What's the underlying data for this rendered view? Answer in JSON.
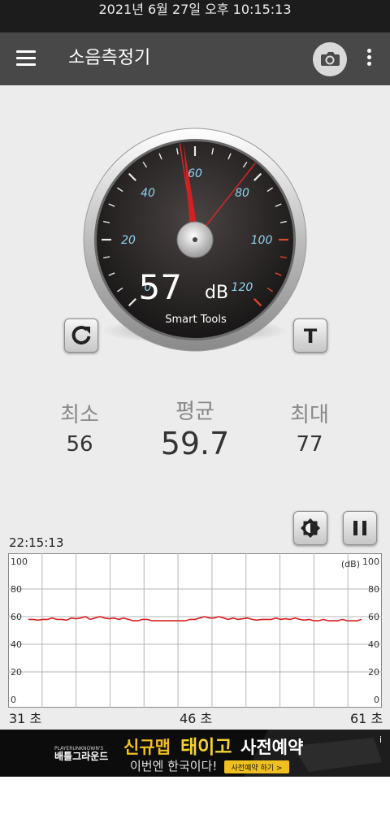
{
  "status_bar": {
    "datetime": "2021년 6월 27일 오후 10:15:13"
  },
  "app_bar": {
    "title": "소음측정기",
    "camera_icon": "camera-icon",
    "menu_icon": "more-vert-icon",
    "nav_icon": "hamburger-icon"
  },
  "gauge": {
    "reading": "57",
    "unit": "dB",
    "brand": "Smart Tools",
    "needle_value": 57,
    "max_marker_value": 77,
    "min_marker_value": 56,
    "scale_labels": [
      "0",
      "20",
      "40",
      "60",
      "80",
      "100",
      "120"
    ],
    "scale_max": 120
  },
  "buttons": {
    "reset_icon": "refresh-icon",
    "calibrate_label": "T",
    "brightness_icon": "brightness-icon",
    "pause_icon": "pause-icon"
  },
  "stats": {
    "min_label": "최소",
    "min_value": "56",
    "avg_label": "평균",
    "avg_value": "59.7",
    "max_label": "최대",
    "max_value": "77"
  },
  "graph": {
    "start_time": "22:15:13",
    "unit_label": "(dB)",
    "y_ticks": [
      "0",
      "20",
      "40",
      "60",
      "80",
      "100"
    ],
    "x_labels": [
      "31 초",
      "46 초",
      "61 초"
    ],
    "line_color": "#d62020"
  },
  "chart_data": {
    "type": "line",
    "ylim": [
      0,
      100
    ],
    "series": [
      {
        "values": [
          58,
          58,
          57.5,
          58,
          58,
          59,
          58,
          58,
          57.5,
          59,
          58.5,
          59,
          60,
          58,
          59,
          60,
          59,
          58.5,
          59,
          58,
          59,
          58,
          57,
          57,
          58,
          58,
          57,
          57,
          57,
          57,
          57,
          57,
          57,
          57,
          58,
          58,
          59,
          60,
          59,
          59,
          60,
          59,
          58,
          59,
          58,
          58.5,
          59,
          58,
          57.5,
          58,
          58,
          58,
          59,
          58,
          58.5,
          58,
          59,
          58,
          57.5,
          58,
          57,
          57,
          58,
          57,
          57,
          57,
          58,
          57,
          57,
          57,
          58
        ]
      }
    ]
  },
  "ad": {
    "game_name": "배틀그라운드",
    "game_tag": "PLAYERUNKNOWN'S",
    "headline_a": "신규맵",
    "headline_b": "태이고",
    "headline_c": "사전예약",
    "subline": "이번엔 한국이다!",
    "cta": "사전예약 하기 >",
    "info": "i"
  }
}
